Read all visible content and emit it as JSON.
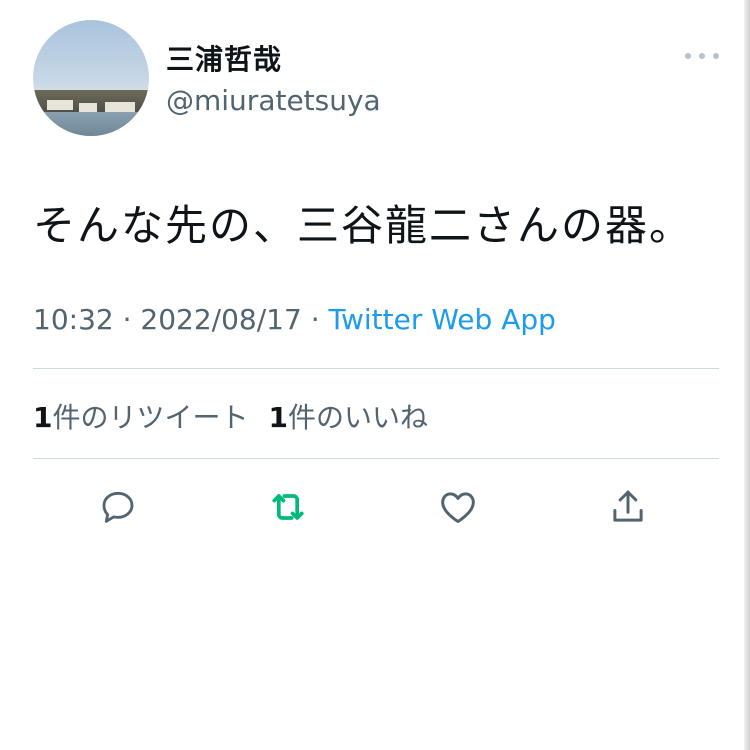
{
  "tweet": {
    "display_name": "三浦哲哉",
    "handle": "@miuratetsuya",
    "text": "そんな先の、三谷龍二さんの器。",
    "time": "10:32",
    "date": "2022/08/17",
    "separator": " · ",
    "source": "Twitter Web App",
    "retweets": {
      "count": "1",
      "label": "件のリツイート"
    },
    "likes": {
      "count": "1",
      "label": "件のいいね"
    }
  },
  "colors": {
    "accent": "#1d9bf0",
    "retweet_active": "#00ba7c",
    "muted": "#536471",
    "icon": "#536471"
  },
  "icons": [
    "more-icon",
    "reply-icon",
    "retweet-icon",
    "like-icon",
    "share-icon"
  ]
}
